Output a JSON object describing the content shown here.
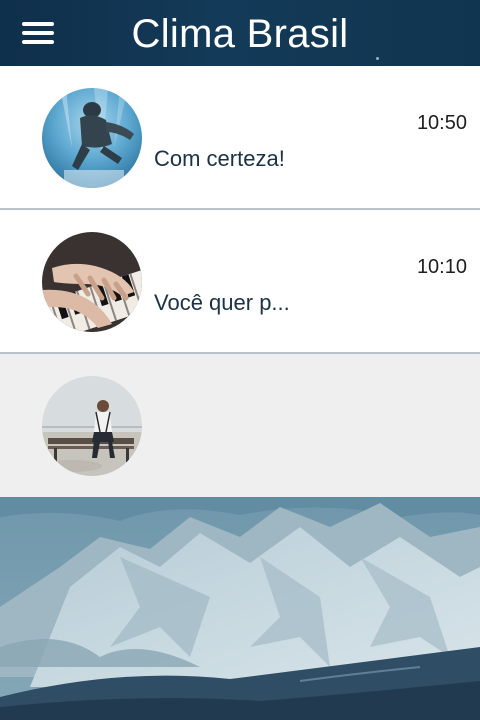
{
  "header": {
    "title": "Clima Brasil",
    "menu_icon": "hamburger-menu-icon",
    "color": "#123754"
  },
  "chats": [
    {
      "time": "10:50",
      "preview": "Com certeza!",
      "avatar_icon": "underwater-person-avatar"
    },
    {
      "time": "10:10",
      "preview": "Você quer p...",
      "avatar_icon": "piano-hands-avatar"
    },
    {
      "time": "",
      "preview": "",
      "avatar_icon": "person-on-bench-avatar"
    }
  ],
  "background": {
    "image": "mountain-landscape-image",
    "tint": "#5f8499"
  }
}
